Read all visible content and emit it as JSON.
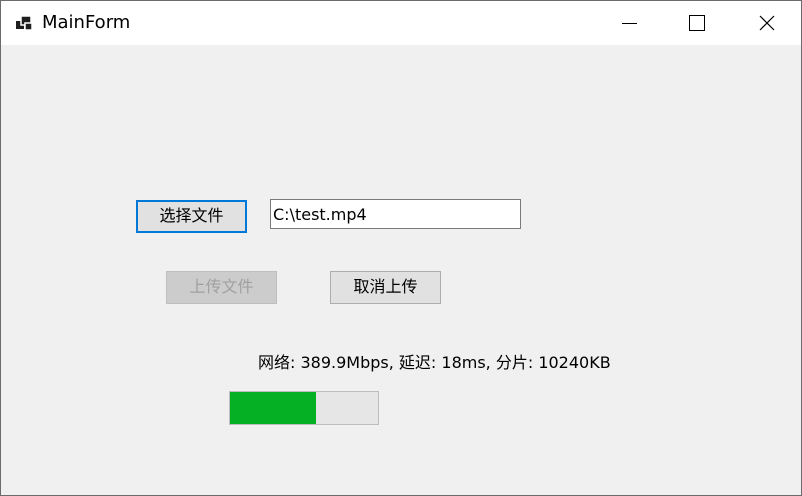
{
  "window": {
    "title": "MainForm",
    "icon": "app-window-icon"
  },
  "caption_buttons": {
    "minimize_icon": "minimize-icon",
    "maximize_icon": "maximize-icon",
    "close_icon": "close-icon"
  },
  "form": {
    "select_file_button": "选择文件",
    "file_path_value": "C:\\test.mp4",
    "upload_button": "上传文件",
    "upload_button_enabled": false,
    "cancel_upload_button": "取消上传",
    "status_text": "网络: 389.9Mbps, 延迟: 18ms, 分片: 10240KB",
    "progress_fraction": 0.58
  },
  "colors": {
    "focus_border": "#0078d7",
    "progress_fill": "#06b025",
    "window_background": "#f0f0f0"
  }
}
